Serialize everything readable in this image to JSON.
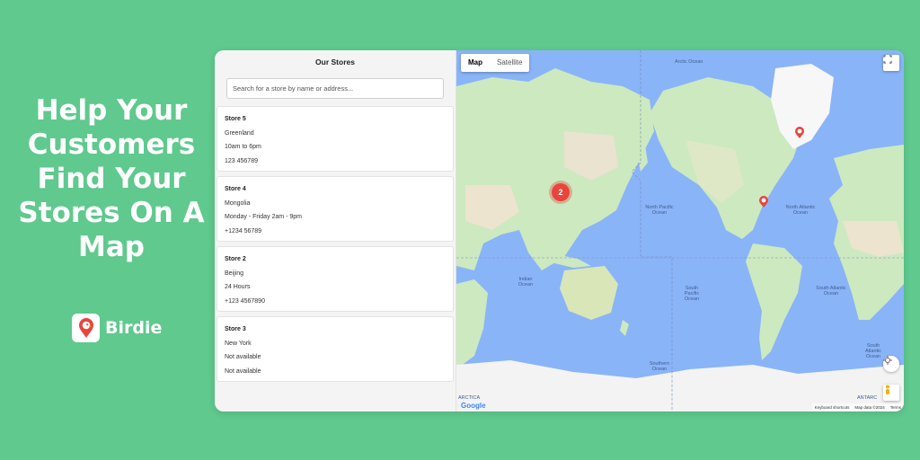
{
  "hero": {
    "lines": [
      "Help Your",
      "Customers",
      "Find Your",
      "Stores On A",
      "Map"
    ]
  },
  "brand": {
    "name": "Birdie",
    "accent": "#e8453c",
    "icon": "birdie-pin-logo-icon"
  },
  "sidebar": {
    "title": "Our Stores",
    "search_placeholder": "Search for a store by name or address..."
  },
  "stores": [
    {
      "name": "Store 5",
      "location": "Greenland",
      "hours": "10am to 6pm",
      "phone": "123 456789"
    },
    {
      "name": "Store 4",
      "location": "Mongolia",
      "hours": "Monday - Friday 2am - 9pm",
      "phone": "+1234 56789"
    },
    {
      "name": "Store 2",
      "location": "Beijing",
      "hours": "24 Hours",
      "phone": "+123 4567890"
    },
    {
      "name": "Store 3",
      "location": "New York",
      "hours": "Not available",
      "phone": "Not available"
    }
  ],
  "map": {
    "type_buttons": {
      "map": "Map",
      "satellite": "Satellite",
      "selected": "Map"
    },
    "cluster_count": "2",
    "labels": {
      "arctic": "Arctic Ocean",
      "north_pacific": "North Pacific Ocean",
      "north_atlantic": "North Atlantic Ocean",
      "indian": "Indian Ocean",
      "south_pacific": "South Pacific Ocean",
      "south_atlantic": "South Atlantic Ocean",
      "southern": "Southern Ocean",
      "antarctica_left": "ARCTICA",
      "antarctica_right": "ANTARC"
    },
    "footer": {
      "shortcuts": "Keyboard shortcuts",
      "data": "Map data ©2024",
      "terms": "Terms"
    },
    "google": "Google",
    "colors": {
      "water": "#8ab4f8",
      "land": "#cde9c0",
      "ice": "#f3f3f3",
      "marker": "#e8453c"
    }
  }
}
